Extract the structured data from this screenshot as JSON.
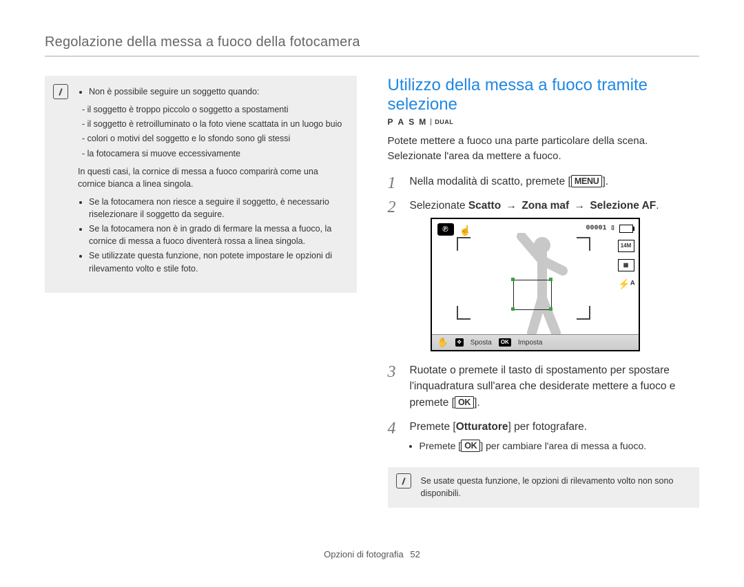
{
  "header": {
    "title": "Regolazione della messa a fuoco della fotocamera"
  },
  "left_note": {
    "b1": "Non è possibile seguire un soggetto quando:",
    "d1": "il soggetto è troppo piccolo o soggetto a spostamenti",
    "d2": "il soggetto è retroilluminato o la foto viene scattata in un luogo buio",
    "d3": "colori o motivi del soggetto e lo sfondo sono gli stessi",
    "d4": "la fotocamera si muove eccessivamente",
    "p1": "In questi casi, la cornice di messa a fuoco comparirà come una cornice bianca a linea singola.",
    "b2": "Se la fotocamera non riesce a seguire il soggetto, è necessario riselezionare il soggetto da seguire.",
    "b3": "Se la fotocamera non è in grado di fermare la messa a fuoco, la cornice di messa a fuoco diventerà rossa a linea singola.",
    "b4": "Se utilizzate questa funzione, non potete impostare le opzioni di rilevamento volto e stile foto."
  },
  "right": {
    "heading": "Utilizzo della messa a fuoco tramite selezione",
    "modes": {
      "p": "P",
      "a": "A",
      "s": "S",
      "m": "M",
      "dual": "DUAL"
    },
    "intro": "Potete mettere a fuoco una parte particolare della scena. Selezionate l'area da mettere a fuoco.",
    "step1_a": "Nella modalità di scatto, premete [",
    "step1_btn": "MENU",
    "step1_b": "].",
    "step2_a": "Selezionate ",
    "step2_bold1": "Scatto",
    "step2_arr1": " → ",
    "step2_bold2": "Zona maf",
    "step2_arr2": " → ",
    "step2_bold3": "Selezione AF",
    "step2_end": ".",
    "cam": {
      "counter": "00001",
      "res": "14M",
      "grid": "▦",
      "flash": "⚡ᴬ",
      "move_label": "Sposta",
      "set_label": "Imposta",
      "ok": "OK"
    },
    "step3_a": "Ruotate o premete il tasto di spostamento per spostare l'inquadratura sull'area che desiderate mettere a fuoco e premete [",
    "step3_btn": "OK",
    "step3_b": "].",
    "step4_a": "Premete [",
    "step4_bold": "Otturatore",
    "step4_b": "] per fotografare.",
    "sub1_a": "Premete [",
    "sub1_btn": "OK",
    "sub1_b": "] per cambiare l'area di messa a fuoco.",
    "slimnote": "Se usate questa funzione, le opzioni di rilevamento volto non sono disponibili."
  },
  "footer": {
    "section": "Opzioni di fotografia",
    "page": "52"
  }
}
